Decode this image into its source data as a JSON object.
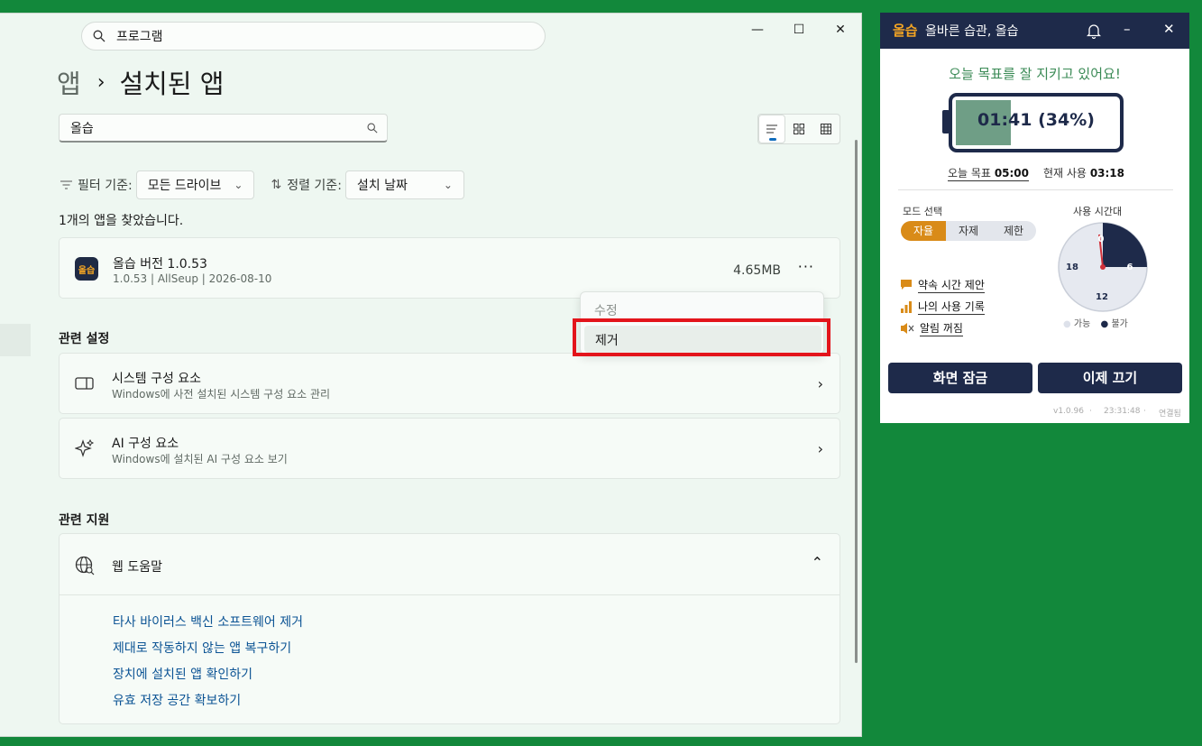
{
  "settings": {
    "search_value": "프로그램",
    "breadcrumb_parent": "앱",
    "breadcrumb_current": "설치된 앱",
    "app_search_value": "올습",
    "filter_label": "필터 기준:",
    "filter_value": "모든 드라이브",
    "sort_label": "정렬 기준:",
    "sort_value": "설치 날짜",
    "found_text": "1개의 앱을 찾았습니다.",
    "app": {
      "icon_text": "올습",
      "name": "올습 버전 1.0.53",
      "meta": "1.0.53  |  AllSeup  |  2026-08-10",
      "size": "4.65MB",
      "more": "···"
    },
    "context_menu": {
      "modify": "수정",
      "uninstall": "제거"
    },
    "related_settings_heading": "관련 설정",
    "related_settings": [
      {
        "title": "시스템 구성 요소",
        "subtitle": "Windows에 사전 설치된 시스템 구성 요소 관리"
      },
      {
        "title": "AI 구성 요소",
        "subtitle": "Windows에 설치된 AI 구성 요소 보기"
      }
    ],
    "related_support_heading": "관련 지원",
    "web_help": "웹 도움말",
    "help_links": [
      "타사 바이러스 백신 소프트웨어 제거",
      "제대로 작동하지 않는 앱 복구하기",
      "장치에 설치된 앱 확인하기",
      "유효 저장 공간 확보하기"
    ]
  },
  "app_window": {
    "logo": "올습",
    "title": "올바른 습관, 올습",
    "goal_message": "오늘 목표를 잘 지키고 있어요!",
    "battery_text": "01:41 (34%)",
    "battery_level_percent": 34,
    "today_goal_label": "오늘 목표",
    "today_goal_value": "05:00",
    "current_use_label": "현재 사용",
    "current_use_value": "03:18",
    "mode_label": "모드 선택",
    "modes": [
      "자율",
      "자제",
      "제한"
    ],
    "active_mode": "자율",
    "menu": [
      "약속 시간 제안",
      "나의 사용 기록",
      "알림 꺼짐"
    ],
    "clock_label": "사용 시간대",
    "clock_ticks": [
      "0",
      "6",
      "12",
      "18"
    ],
    "legend_available": "가능",
    "legend_blocked": "불가",
    "lock_button": "화면 잠금",
    "end_button": "이제 끄기",
    "version": "v1.0.96",
    "time": "23:31:48",
    "status": "연결됨",
    "colors": {
      "navy": "#1e2a4a",
      "orange": "#d98b18",
      "green": "#3a8a55"
    }
  }
}
